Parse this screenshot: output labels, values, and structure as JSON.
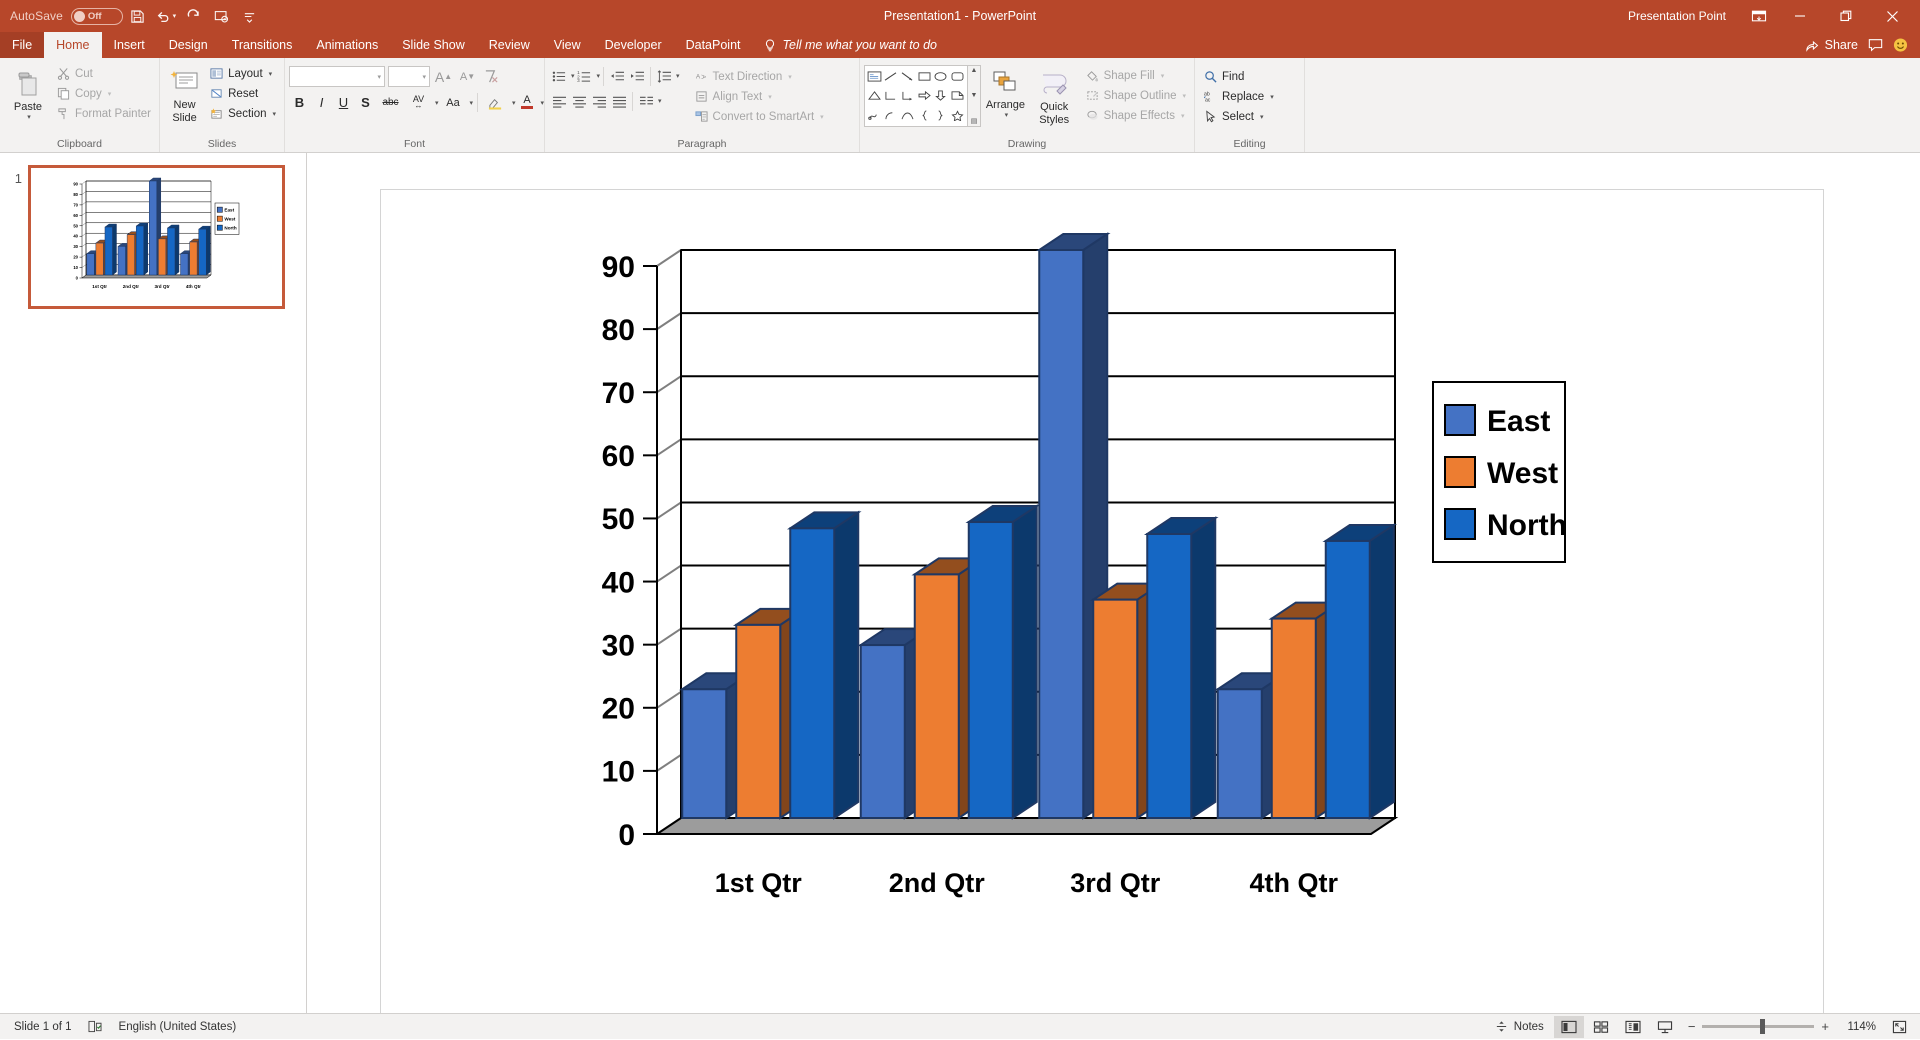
{
  "titlebar": {
    "autosave_label": "AutoSave",
    "autosave_state": "Off",
    "save_icon": "save-icon",
    "undo_icon": "undo-icon",
    "redo_icon": "redo-icon",
    "present_icon": "start-presentation-icon",
    "customize_icon": "customize-qat-icon",
    "title": "Presentation1  -  PowerPoint",
    "user": "Presentation Point",
    "ribbon_display_icon": "ribbon-display-options-icon",
    "minimize_icon": "minimize-icon",
    "restore_icon": "restore-icon",
    "close_icon": "close-icon"
  },
  "tabs": [
    {
      "label": "File",
      "kind": "file"
    },
    {
      "label": "Home",
      "kind": "active"
    },
    {
      "label": "Insert",
      "kind": "normal"
    },
    {
      "label": "Design",
      "kind": "normal"
    },
    {
      "label": "Transitions",
      "kind": "normal"
    },
    {
      "label": "Animations",
      "kind": "normal"
    },
    {
      "label": "Slide Show",
      "kind": "normal"
    },
    {
      "label": "Review",
      "kind": "normal"
    },
    {
      "label": "View",
      "kind": "normal"
    },
    {
      "label": "Developer",
      "kind": "normal"
    },
    {
      "label": "DataPoint",
      "kind": "normal"
    }
  ],
  "tellme": {
    "label": "Tell me what you want to do",
    "icon": "lightbulb-icon"
  },
  "share": {
    "label": "Share",
    "icon": "share-icon"
  },
  "comments_icon": "comments-icon",
  "feedback_icon": "smiley-icon",
  "ribbon": {
    "clipboard": {
      "title": "Clipboard",
      "paste": "Paste",
      "cut": "Cut",
      "copy": "Copy",
      "format_painter": "Format Painter"
    },
    "slides": {
      "title": "Slides",
      "new_slide_line1": "New",
      "new_slide_line2": "Slide",
      "layout": "Layout",
      "reset": "Reset",
      "section": "Section"
    },
    "font": {
      "title": "Font",
      "fontname_value": "",
      "fontsize_value": "",
      "bold": "B",
      "italic": "I",
      "underline": "U",
      "shadow": "S",
      "strikethrough": "abc",
      "spacing": "AV",
      "change_case": "Aa",
      "highlight": "ab",
      "font_color": "A"
    },
    "paragraph": {
      "title": "Paragraph",
      "text_direction": "Text Direction",
      "align_text": "Align Text",
      "convert_smartart": "Convert to SmartArt"
    },
    "drawing": {
      "title": "Drawing",
      "arrange": "Arrange",
      "quick_styles_line1": "Quick",
      "quick_styles_line2": "Styles",
      "shape_fill": "Shape Fill",
      "shape_outline": "Shape Outline",
      "shape_effects": "Shape Effects"
    },
    "editing": {
      "title": "Editing",
      "find": "Find",
      "replace": "Replace",
      "select": "Select"
    }
  },
  "thumbnails": [
    {
      "number": "1"
    }
  ],
  "statusbar": {
    "slide_count": "Slide 1 of 1",
    "language": "English (United States)",
    "accessibility_icon": "accessibility-icon",
    "notes": "Notes",
    "notes_icon": "notes-icon",
    "views": [
      {
        "name": "normal-view",
        "icon": "normal-view-icon",
        "active": true
      },
      {
        "name": "slide-sorter-view",
        "icon": "slide-sorter-icon",
        "active": false
      },
      {
        "name": "reading-view",
        "icon": "reading-view-icon",
        "active": false
      },
      {
        "name": "slide-show-view",
        "icon": "slide-show-icon",
        "active": false
      }
    ],
    "zoom_out": "−",
    "zoom_in": "+",
    "zoom_level": "114%",
    "fit_icon": "fit-slide-icon"
  },
  "chart_data": {
    "type": "bar",
    "style": "3d-clustered-column",
    "title": "",
    "xlabel": "",
    "ylabel": "",
    "categories": [
      "1st Qtr",
      "2nd Qtr",
      "3rd Qtr",
      "4th Qtr"
    ],
    "series": [
      {
        "name": "East",
        "color": "#4472C4",
        "values": [
          20.4,
          27.4,
          90.0,
          20.4
        ]
      },
      {
        "name": "West",
        "color": "#ED7D31",
        "values": [
          30.6,
          38.6,
          34.6,
          31.6
        ]
      },
      {
        "name": "North",
        "color": "#1567C4",
        "values": [
          45.9,
          46.9,
          45.0,
          43.9
        ]
      }
    ],
    "ylim": [
      0,
      90
    ],
    "yticks": [
      0,
      10,
      20,
      30,
      40,
      50,
      60,
      70,
      80,
      90
    ],
    "ytick_labels": [
      "0",
      "10",
      "20",
      "30",
      "40",
      "50",
      "60",
      "70",
      "80",
      "90"
    ],
    "grid": true,
    "legend": true,
    "legend_position": "right",
    "legend_entries": [
      "East",
      "West",
      "North"
    ]
  },
  "theme": {
    "accent": "#b7472a",
    "ribbon_bg": "#f3f2f1",
    "east_color": "#4472C4",
    "west_color": "#ED7D31",
    "north_color": "#1567C4",
    "selection_border": "#c55a3a"
  }
}
